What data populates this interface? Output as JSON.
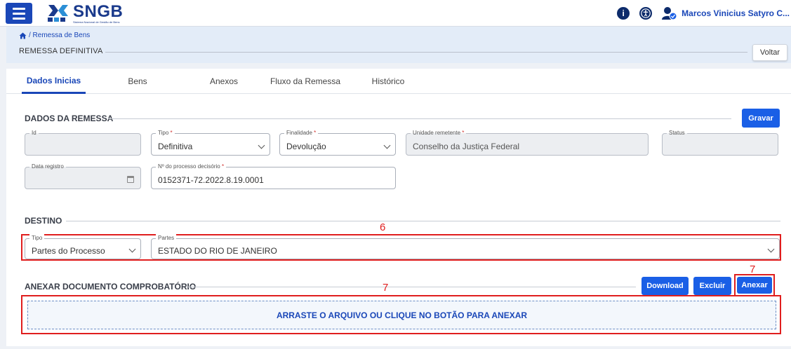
{
  "app": {
    "logo_title": "SNGB",
    "logo_subtitle": "Sistema Nacional de Gestão de Bens",
    "user_name": "Marcos Vinicius Satyro C...",
    "info_icon": "info-icon",
    "accessibility_icon": "accessibility-icon",
    "user_icon": "user-settings-icon"
  },
  "colors": {
    "primary": "#1a5fe6",
    "brand": "#1a3a8c",
    "annotation": "#e01e1e"
  },
  "header": {
    "breadcrumb": "/ Remessa de Bens",
    "title": "REMESSA DEFINITIVA",
    "back_label": "Voltar"
  },
  "tabs": [
    {
      "label": "Dados Inicias",
      "active": true
    },
    {
      "label": "Bens"
    },
    {
      "label": "Anexos"
    },
    {
      "label": "Fluxo da Remessa"
    },
    {
      "label": "Histórico"
    }
  ],
  "remessa": {
    "section_title": "DADOS DA REMESSA",
    "save_label": "Gravar",
    "id": {
      "label": "Id",
      "value": ""
    },
    "tipo": {
      "label": "Tipo",
      "required": "*",
      "value": "Definitiva"
    },
    "finalidade": {
      "label": "Finalidade",
      "required": "*",
      "value": "Devolução"
    },
    "unidade": {
      "label": "Unidade remetente",
      "required": "*",
      "value": "Conselho da Justiça Federal"
    },
    "status": {
      "label": "Status",
      "value": ""
    },
    "data_registro": {
      "label": "Data registro",
      "value": ""
    },
    "processo": {
      "label": "Nº do processo decisório",
      "required": "*",
      "value": "0152371-72.2022.8.19.0001"
    }
  },
  "destino": {
    "section_title": "DESTINO",
    "tipo": {
      "label": "Tipo",
      "value": "Partes do Processo"
    },
    "partes": {
      "label": "Partes",
      "value": "ESTADO DO RIO DE JANEIRO"
    }
  },
  "anexo": {
    "section_title": "ANEXAR DOCUMENTO COMPROBATÓRIO",
    "download_label": "Download",
    "excluir_label": "Excluir",
    "anexar_label": "Anexar",
    "dropzone_text": "ARRASTE O ARQUIVO OU CLIQUE NO BOTÃO PARA ANEXAR"
  },
  "annotations": {
    "destino_number": "6",
    "dropzone_number": "7",
    "anexar_number": "7"
  }
}
